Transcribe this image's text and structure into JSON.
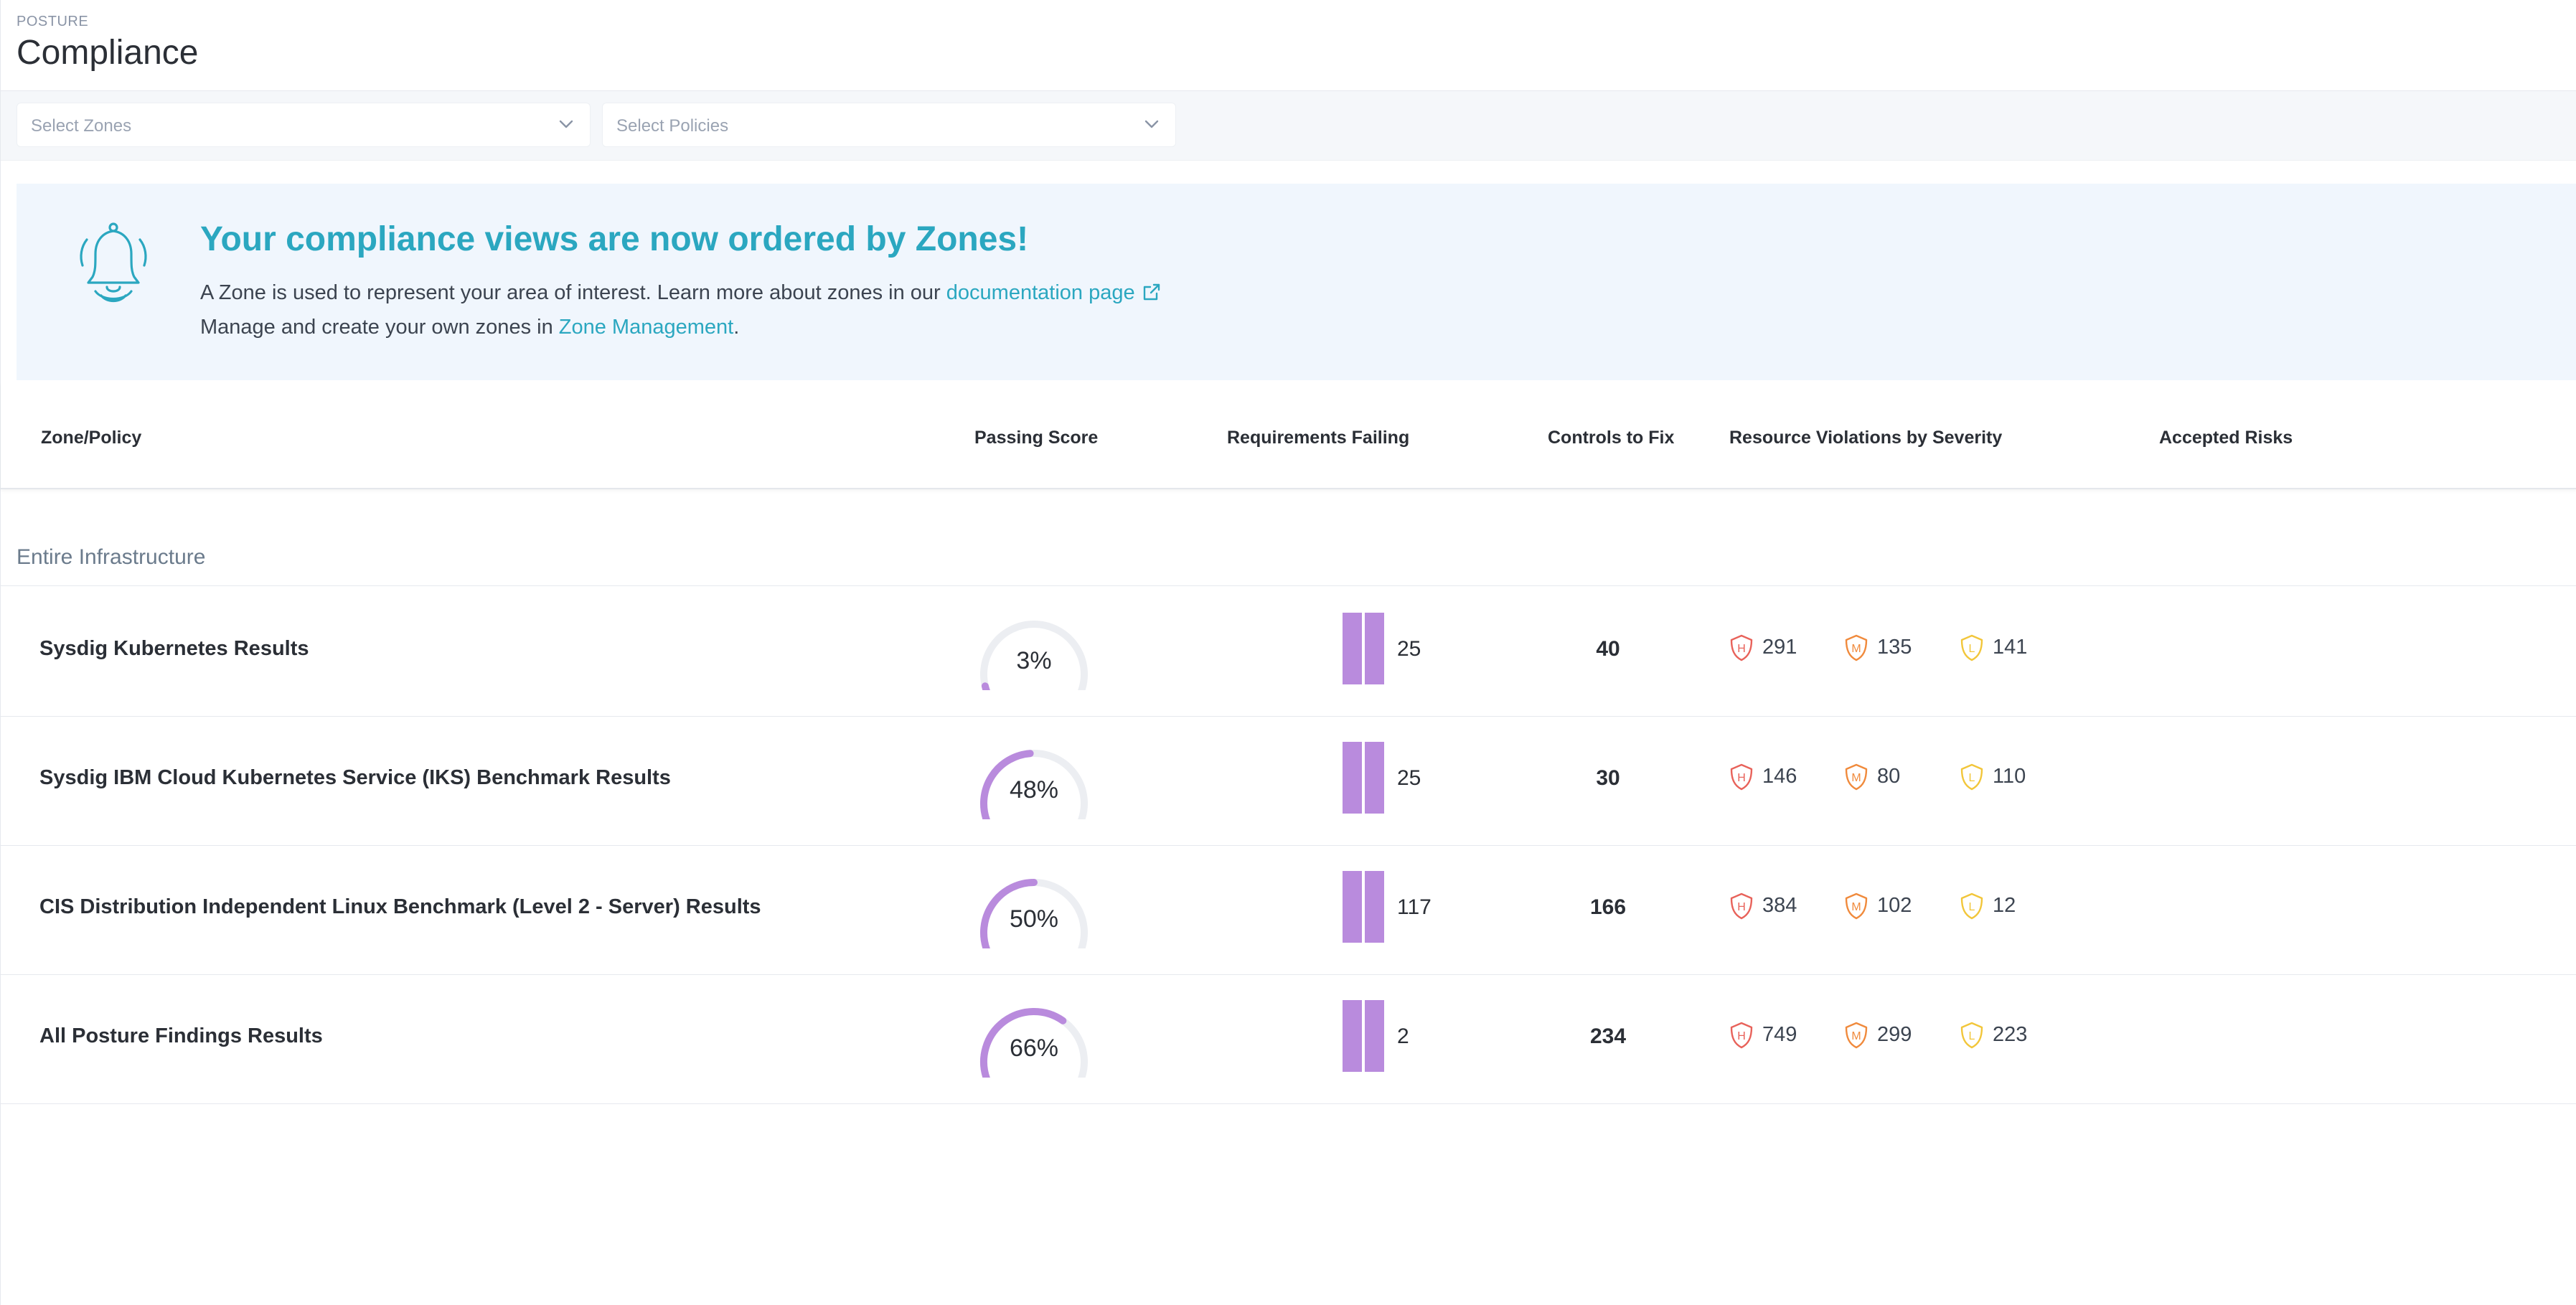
{
  "header": {
    "section": "POSTURE",
    "title": "Compliance"
  },
  "filters": {
    "zones_placeholder": "Select Zones",
    "policies_placeholder": "Select Policies"
  },
  "banner": {
    "title": "Your compliance views are now ordered by Zones!",
    "line1_prefix": "A Zone is used to represent your area of interest. Learn more about zones in our ",
    "line1_link": "documentation page",
    "line2_prefix": "Manage and create your own zones in ",
    "line2_link": "Zone Management",
    "line2_suffix": ".",
    "icon": "bell-icon",
    "accent_color": "#2ba7c0"
  },
  "table": {
    "columns": [
      "Zone/Policy",
      "Passing Score",
      "Requirements Failing",
      "Controls to Fix",
      "Resource Violations by Severity",
      "Accepted Risks"
    ],
    "group_label": "Entire Infrastructure",
    "rows": [
      {
        "name": "Sysdig Kubernetes Results",
        "score_label": "3%",
        "score": 3,
        "requirements_failing": "25",
        "controls_to_fix": "40",
        "high": "291",
        "medium": "135",
        "low": "141"
      },
      {
        "name": "Sysdig IBM Cloud Kubernetes Service (IKS) Benchmark Results",
        "score_label": "48%",
        "score": 48,
        "requirements_failing": "25",
        "controls_to_fix": "30",
        "high": "146",
        "medium": "80",
        "low": "110"
      },
      {
        "name": "CIS Distribution Independent Linux Benchmark (Level 2 - Server) Results",
        "score_label": "50%",
        "score": 50,
        "requirements_failing": "117",
        "controls_to_fix": "166",
        "high": "384",
        "medium": "102",
        "low": "12"
      },
      {
        "name": "All Posture Findings Results",
        "score_label": "66%",
        "score": 66,
        "requirements_failing": "2",
        "controls_to_fix": "234",
        "high": "749",
        "medium": "299",
        "low": "223"
      }
    ],
    "severity_labels": {
      "high": "H",
      "medium": "M",
      "low": "L"
    }
  },
  "colors": {
    "gauge_fill": "#b98bdd",
    "gauge_track": "#eceef2",
    "high": "#e8625a",
    "medium": "#f08a3c",
    "low": "#f2c63a"
  }
}
